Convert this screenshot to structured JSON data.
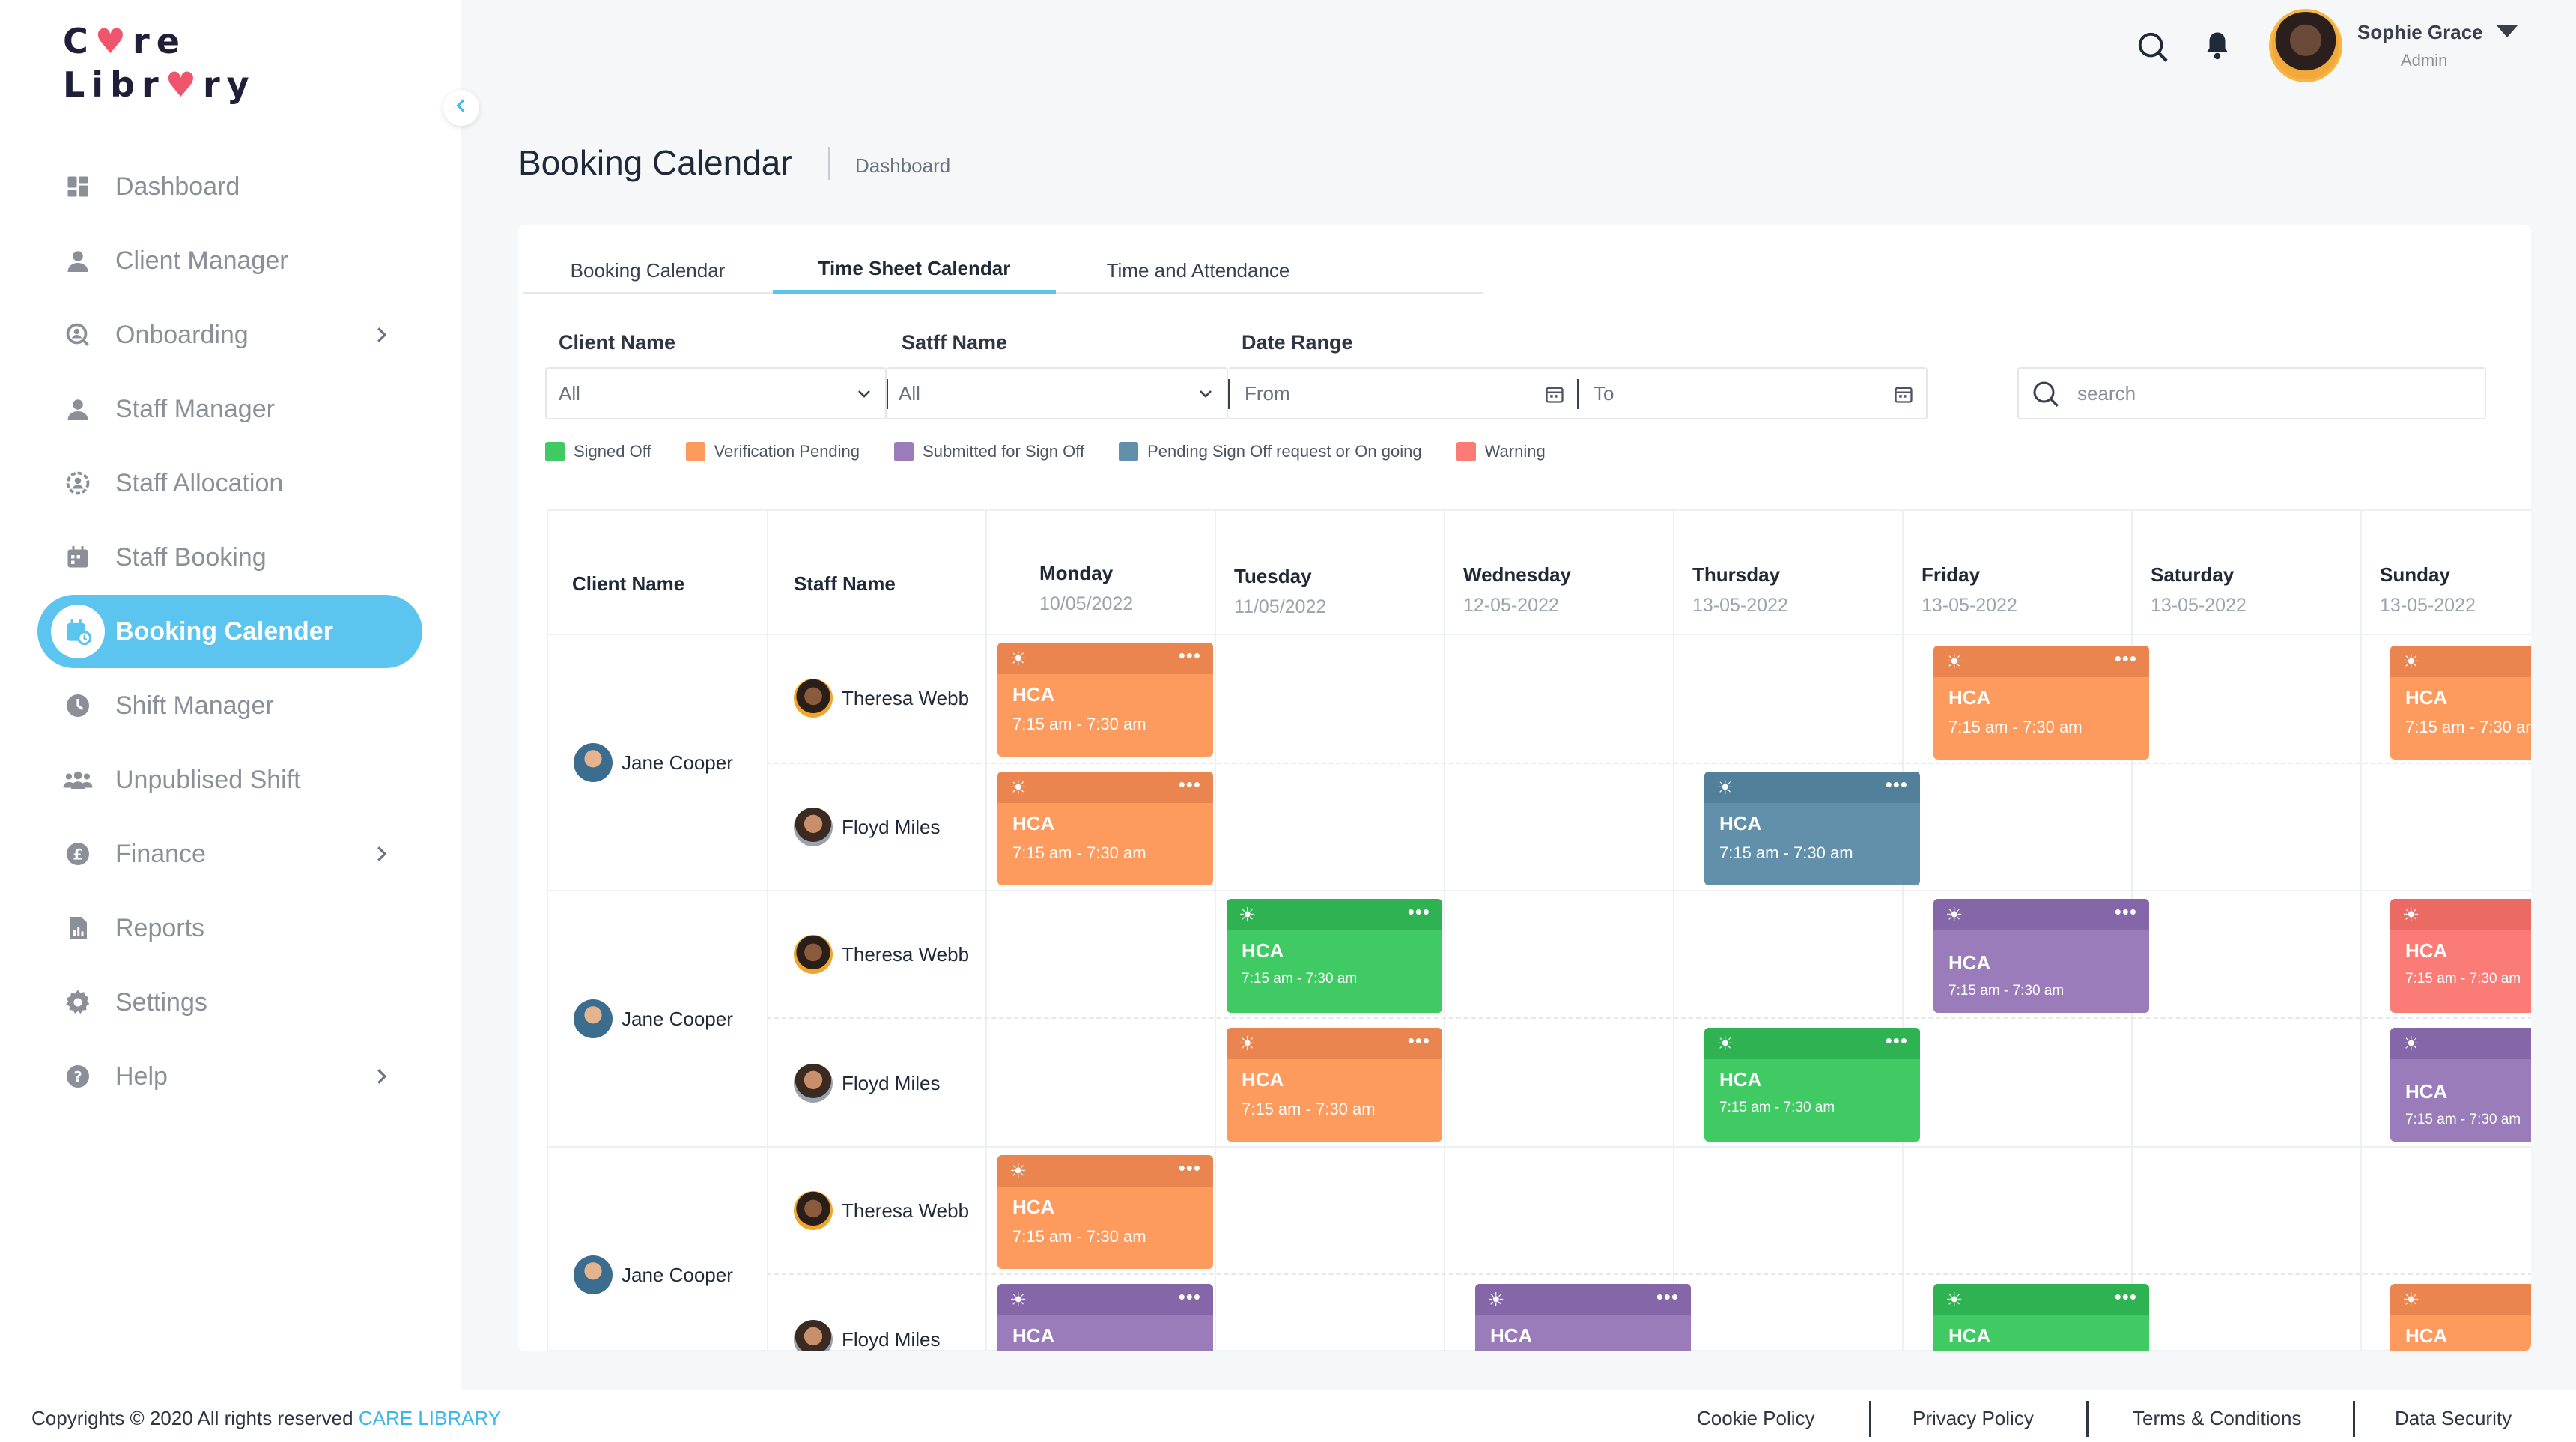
{
  "app": {
    "logo_line1_a": "C",
    "logo_line1_heart": "♥",
    "logo_line1_b": "re",
    "logo_line2_a": "Libr",
    "logo_line2_heart": "♥",
    "logo_line2_b": "ry"
  },
  "sidebar": {
    "items": [
      {
        "label": "Dashboard",
        "icon": "dashboard-icon"
      },
      {
        "label": "Client Manager",
        "icon": "user-icon"
      },
      {
        "label": "Onboarding",
        "icon": "onboarding-icon",
        "has_submenu": true
      },
      {
        "label": "Staff Manager",
        "icon": "user-icon"
      },
      {
        "label": "Staff Allocation",
        "icon": "allocation-icon"
      },
      {
        "label": "Staff Booking",
        "icon": "calendar-icon"
      },
      {
        "label": "Booking Calender",
        "icon": "calendar-edit-icon",
        "active": true
      },
      {
        "label": "Shift Manager",
        "icon": "clock-icon"
      },
      {
        "label": "Unpublised Shift",
        "icon": "group-icon"
      },
      {
        "label": "Finance",
        "icon": "pound-icon",
        "has_submenu": true
      },
      {
        "label": "Reports",
        "icon": "report-icon"
      },
      {
        "label": "Settings",
        "icon": "gear-icon"
      },
      {
        "label": "Help",
        "icon": "help-icon",
        "has_submenu": true
      }
    ]
  },
  "user": {
    "name": "Sophie Grace",
    "role": "Admin"
  },
  "header": {
    "title": "Booking Calendar",
    "breadcrumb": "Dashboard"
  },
  "tabs": [
    {
      "label": "Booking Calendar"
    },
    {
      "label": "Time Sheet Calendar",
      "active": true
    },
    {
      "label": "Time and Attendance"
    }
  ],
  "filters": {
    "client_label": "Client Name",
    "client_value": "All",
    "staff_label": "Satff Name",
    "staff_value": "All",
    "date_label": "Date Range",
    "from_placeholder": "From",
    "to_placeholder": "To",
    "search_placeholder": "search"
  },
  "legend": [
    {
      "label": "Signed Off",
      "color": "#3fca63"
    },
    {
      "label": "Verification Pending",
      "color": "#fd9b5e"
    },
    {
      "label": "Submitted for Sign Off",
      "color": "#9a7cbb"
    },
    {
      "label": "Pending Sign Off request or On going",
      "color": "#6290aa"
    },
    {
      "label": "Warning",
      "color": "#fb7c76"
    }
  ],
  "calendar": {
    "col_client": "Client  Name",
    "col_staff": "Staff Name",
    "days": [
      {
        "name": "Monday",
        "date": "10/05/2022"
      },
      {
        "name": "Tuesday",
        "date": "11/05/2022"
      },
      {
        "name": "Wednesday",
        "date": "12-05-2022"
      },
      {
        "name": "Thursday",
        "date": "13-05-2022"
      },
      {
        "name": "Friday",
        "date": "13-05-2022"
      },
      {
        "name": "Saturday",
        "date": "13-05-2022"
      },
      {
        "name": "Sunday",
        "date": "13-05-2022"
      }
    ],
    "clients": [
      "Jane Cooper",
      "Jane Cooper",
      "Jane Cooper"
    ],
    "staff": [
      "Theresa Webb",
      "Floyd Miles",
      "Theresa Webb",
      "Floyd Miles",
      "Theresa Webb",
      "Floyd Miles"
    ],
    "shift_role": "HCA",
    "shift_time": "7:15 am - 7:30 am"
  },
  "footer": {
    "copyright": "Copyrights © 2020  All rights reserved",
    "brand": "CARE LIBRARY",
    "links": [
      "Cookie Policy",
      "Privacy Policy",
      "Terms & Conditions",
      "Data Security"
    ]
  }
}
